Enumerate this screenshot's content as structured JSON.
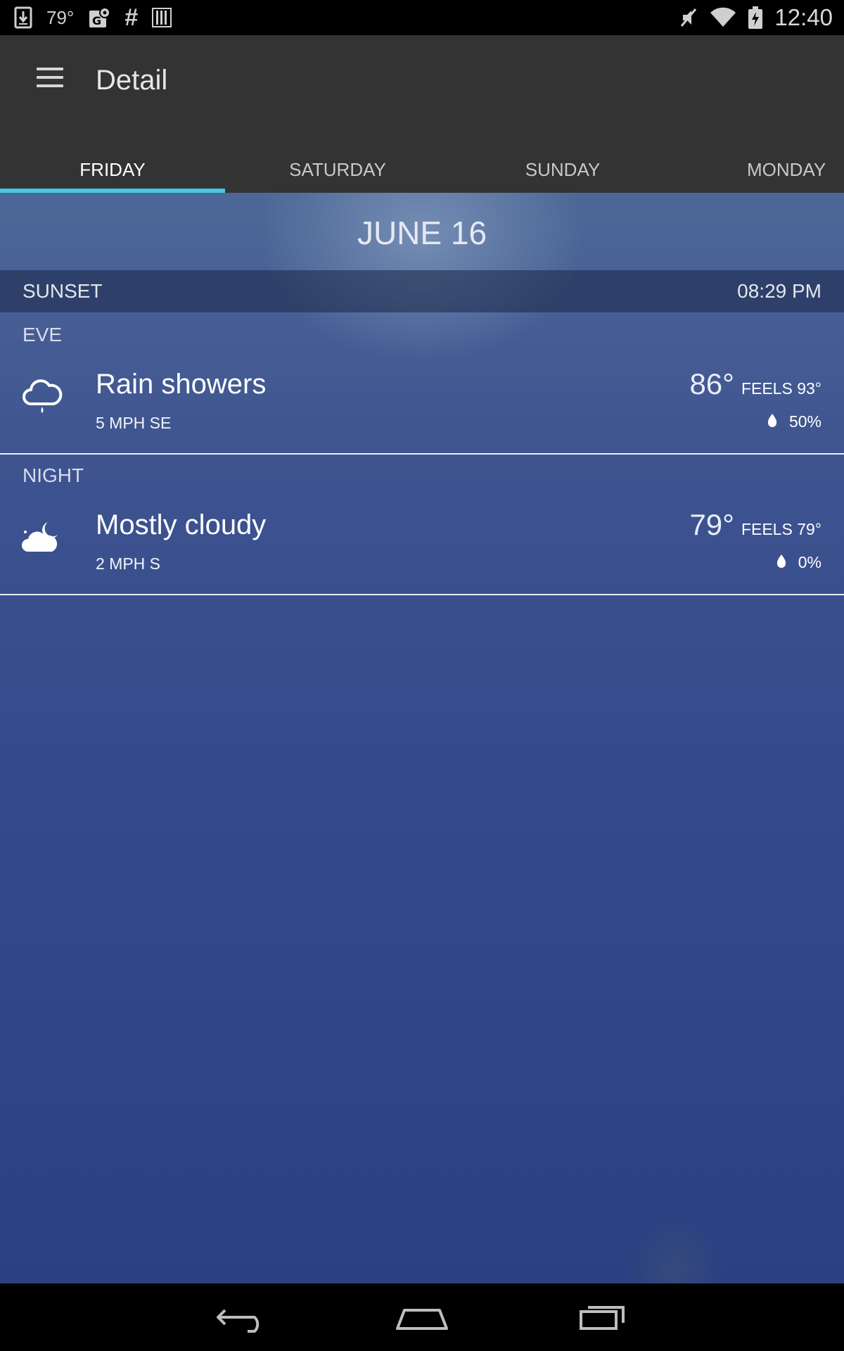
{
  "status_bar": {
    "temperature": "79°",
    "time": "12:40",
    "icons": [
      "download-icon",
      "maps-icon",
      "hash-icon",
      "barcode-icon",
      "mute-icon",
      "wifi-icon",
      "battery-charging-icon"
    ]
  },
  "app_bar": {
    "title": "Detail",
    "tabs": [
      {
        "label": "FRIDAY",
        "active": true
      },
      {
        "label": "SATURDAY",
        "active": false
      },
      {
        "label": "SUNDAY",
        "active": false
      },
      {
        "label": "MONDAY",
        "active": false
      }
    ],
    "accent_color": "#49c7e3"
  },
  "day": {
    "date": "JUNE 16",
    "sunset_label": "SUNSET",
    "sunset_time": "08:29 PM",
    "periods": [
      {
        "label": "EVE",
        "condition": "Rain showers",
        "icon": "rain-cloud-icon",
        "wind": "5 MPH SE",
        "temp": "86°",
        "feels": "FEELS 93°",
        "precip": "50%"
      },
      {
        "label": "NIGHT",
        "condition": "Mostly cloudy",
        "icon": "cloudy-night-icon",
        "wind": "2 MPH S",
        "temp": "79°",
        "feels": "FEELS 79°",
        "precip": "0%"
      }
    ]
  },
  "nav_bar": {
    "buttons": [
      "back-icon",
      "home-icon",
      "recents-icon"
    ]
  }
}
